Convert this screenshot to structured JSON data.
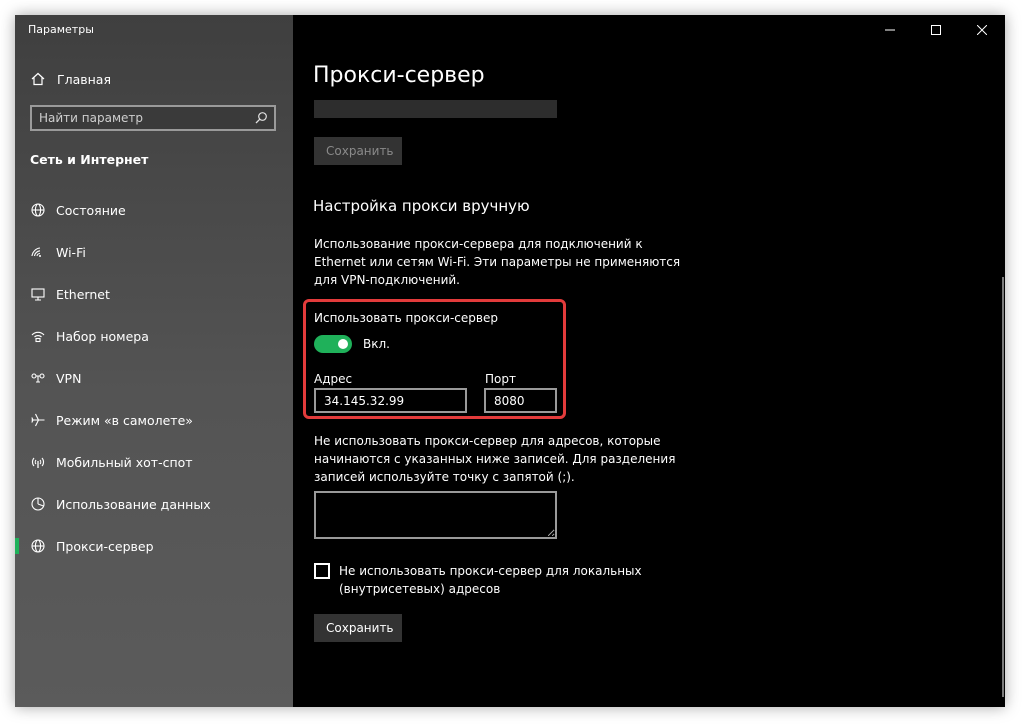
{
  "window": {
    "title": "Параметры",
    "controls": [
      "minimize",
      "maximize",
      "close"
    ]
  },
  "sidebar": {
    "home_label": "Главная",
    "search": {
      "placeholder": "Найти параметр",
      "value": ""
    },
    "category_title": "Сеть и Интернет",
    "items": [
      {
        "label": "Состояние",
        "icon": "globe-status-icon",
        "active": false
      },
      {
        "label": "Wi-Fi",
        "icon": "wifi-icon",
        "active": false
      },
      {
        "label": "Ethernet",
        "icon": "ethernet-icon",
        "active": false
      },
      {
        "label": "Набор номера",
        "icon": "dialup-icon",
        "active": false
      },
      {
        "label": "VPN",
        "icon": "vpn-icon",
        "active": false
      },
      {
        "label": "Режим «в самолете»",
        "icon": "airplane-icon",
        "active": false
      },
      {
        "label": "Мобильный хот-спот",
        "icon": "hotspot-icon",
        "active": false
      },
      {
        "label": "Использование данных",
        "icon": "data-usage-icon",
        "active": false
      },
      {
        "label": "Прокси-сервер",
        "icon": "globe-icon",
        "active": true
      }
    ],
    "accent_color": "#1fb15a"
  },
  "main": {
    "page_title": "Прокси-сервер",
    "script_address_value": "",
    "save_disabled_label": "Сохранить",
    "manual_section_title": "Настройка прокси вручную",
    "manual_description": "Использование прокси-сервера для подключений к Ethernet или сетям Wi-Fi. Эти параметры не применяются для VPN-подключений.",
    "use_proxy_label": "Использовать прокси-сервер",
    "use_proxy_state": "Вкл.",
    "use_proxy_on": true,
    "address_label": "Адрес",
    "address_value": "34.145.32.99",
    "port_label": "Порт",
    "port_value": "8080",
    "exceptions_description": "Не использовать прокси-сервер для адресов, которые начинаются с указанных ниже записей. Для разделения записей используйте точку с запятой (;).",
    "exceptions_value": "",
    "local_bypass_label": "Не использовать прокси-сервер для локальных (внутрисетевых) адресов",
    "local_bypass_checked": false,
    "save_label": "Сохранить",
    "highlight_color": "#e23b3b"
  }
}
